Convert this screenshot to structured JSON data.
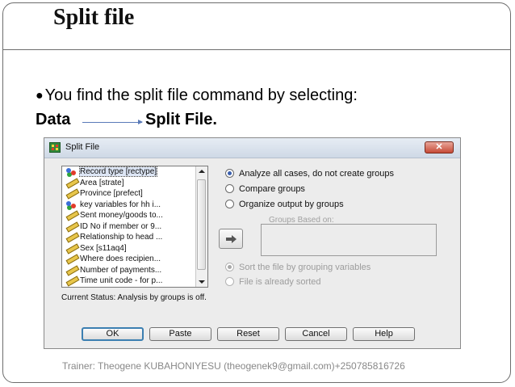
{
  "slide": {
    "title": "Split file",
    "bullet": "You find the split file command by selecting:",
    "bullet_symbol": "●",
    "path_from": "Data",
    "path_to": "Split File.",
    "footer": "Trainer: Theogene KUBAHONIYESU (theogenek9@gmail.com)+250785816726"
  },
  "dialog": {
    "title": "Split File",
    "close_label": "✕",
    "variables": [
      {
        "label": "Record type [rectype]",
        "icon": "nominal-icon"
      },
      {
        "label": "Area [strate]",
        "icon": "ruler-icon"
      },
      {
        "label": "Province [prefect]",
        "icon": "ruler-icon"
      },
      {
        "label": "key variables for hh i...",
        "icon": "nominal-icon"
      },
      {
        "label": "Sent money/goods to...",
        "icon": "ruler-icon"
      },
      {
        "label": "ID No if member or 9...",
        "icon": "ruler-icon"
      },
      {
        "label": "Relationship to head ...",
        "icon": "ruler-icon"
      },
      {
        "label": "Sex [s11aq4]",
        "icon": "ruler-icon"
      },
      {
        "label": "Where does recipien...",
        "icon": "ruler-icon"
      },
      {
        "label": "Number of payments...",
        "icon": "ruler-icon"
      },
      {
        "label": "Time unit code - for p...",
        "icon": "ruler-icon"
      }
    ],
    "options": {
      "analyze_all": "Analyze all cases, do not create groups",
      "compare_groups": "Compare groups",
      "organize_output": "Organize output by groups",
      "selected": "analyze_all"
    },
    "groups_based_on_label": "Groups Based on:",
    "sort_options": {
      "sort_file": "Sort the file by grouping variables",
      "already_sorted": "File is already sorted"
    },
    "status": "Current Status: Analysis by groups is off.",
    "buttons": {
      "ok": "OK",
      "paste": "Paste",
      "reset": "Reset",
      "cancel": "Cancel",
      "help": "Help"
    }
  }
}
